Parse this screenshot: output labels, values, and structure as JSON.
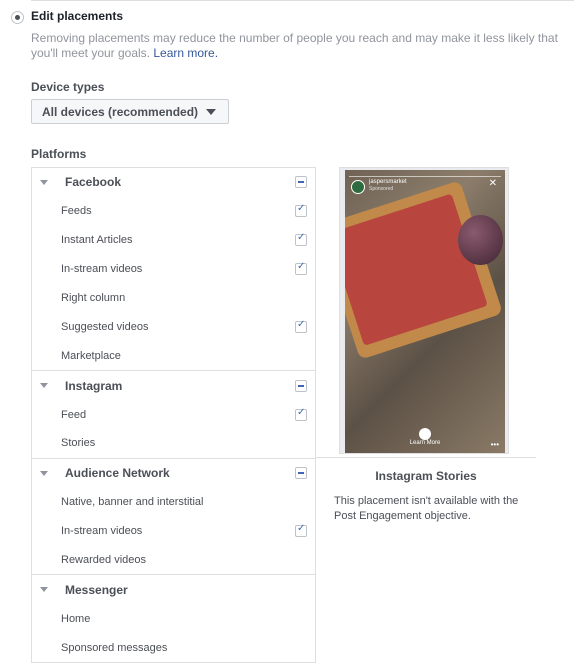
{
  "header": {
    "title": "Edit placements",
    "description": "Removing placements may reduce the number of people you reach and may make it less likely that you'll meet your goals.",
    "learn_more": "Learn more."
  },
  "device_types": {
    "label": "Device types",
    "selected": "All devices (recommended)"
  },
  "platforms": {
    "label": "Platforms",
    "groups": [
      {
        "name": "Facebook",
        "items": [
          {
            "label": "Feeds",
            "checked": true
          },
          {
            "label": "Instant Articles",
            "checked": true
          },
          {
            "label": "In-stream videos",
            "checked": true
          },
          {
            "label": "Right column",
            "checked": false
          },
          {
            "label": "Suggested videos",
            "checked": true
          },
          {
            "label": "Marketplace",
            "checked": false
          }
        ]
      },
      {
        "name": "Instagram",
        "items": [
          {
            "label": "Feed",
            "checked": true
          },
          {
            "label": "Stories",
            "checked": false
          }
        ]
      },
      {
        "name": "Audience Network",
        "items": [
          {
            "label": "Native, banner and interstitial",
            "checked": false
          },
          {
            "label": "In-stream videos",
            "checked": true
          },
          {
            "label": "Rewarded videos",
            "checked": false
          }
        ]
      },
      {
        "name": "Messenger",
        "items": [
          {
            "label": "Home",
            "checked": false
          },
          {
            "label": "Sponsored messages",
            "checked": false
          }
        ]
      }
    ]
  },
  "preview": {
    "account_name": "jaspersmarket",
    "sponsored": "Sponsored",
    "cta": "Learn More",
    "title": "Instagram Stories",
    "note": "This placement isn't available with the Post Engagement objective."
  }
}
